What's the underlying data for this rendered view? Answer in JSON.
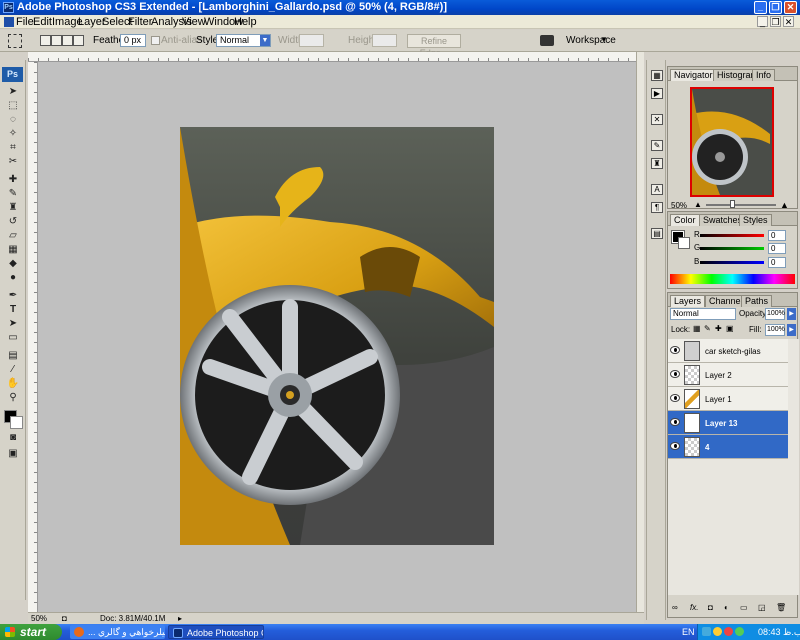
{
  "window": {
    "title": "Adobe Photoshop CS3 Extended - [Lamborghini_Gallardo.psd @ 50% (4, RGB/8#)]",
    "app_icon": "Ps"
  },
  "menu": [
    "File",
    "Edit",
    "Image",
    "Layer",
    "Select",
    "Filter",
    "Analysis",
    "View",
    "Window",
    "Help"
  ],
  "options": {
    "feather_label": "Feather:",
    "feather_value": "0 px",
    "antialias_label": "Anti-alias",
    "style_label": "Style:",
    "style_value": "Normal",
    "width_label": "Width:",
    "height_label": "Height:",
    "refine_edge": "Refine Edge...",
    "workspace": "Workspace"
  },
  "toolbox": {
    "logo": "Ps"
  },
  "status": {
    "zoom": "50%",
    "doc": "Doc: 3.81M/40.1M"
  },
  "navigator": {
    "tabs": [
      "Navigator",
      "Histogram",
      "Info"
    ],
    "zoom": "50%"
  },
  "color_panel": {
    "tabs": [
      "Color",
      "Swatches",
      "Styles"
    ],
    "r_label": "R",
    "g_label": "G",
    "b_label": "B",
    "r_value": "0",
    "g_value": "0",
    "b_value": "0"
  },
  "layers_panel": {
    "tabs": [
      "Layers",
      "Channels",
      "Paths"
    ],
    "blend_mode": "Normal",
    "opacity_label": "Opacity:",
    "opacity_value": "100%",
    "lock_label": "Lock:",
    "fill_label": "Fill:",
    "fill_value": "100%",
    "layers": [
      {
        "name": "car sketch-gilas",
        "selected": false
      },
      {
        "name": "Layer 2",
        "selected": false
      },
      {
        "name": "Layer 1",
        "selected": false
      },
      {
        "name": "Layer 13",
        "selected": true
      },
      {
        "name": "4",
        "selected": true
      }
    ]
  },
  "taskbar": {
    "start": "start",
    "buttons": [
      {
        "label": "... تيلرخواهي و گالري - "
      },
      {
        "label": "Adobe Photoshop CS..."
      }
    ],
    "lang": "EN",
    "clock": "08:43 ب.ظ"
  },
  "colors": {
    "title_bar": "#0046c8",
    "selected_layer": "#3169c6",
    "canvas_bg": "#c0c0c0",
    "car_yellow": "#d9a013"
  }
}
